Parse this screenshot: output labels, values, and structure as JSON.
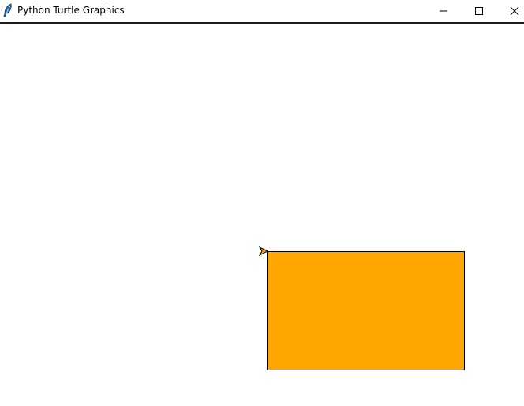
{
  "window": {
    "title": "Python Turtle Graphics",
    "controls": {
      "minimize_icon": "minimize-icon",
      "maximize_icon": "maximize-icon",
      "close_icon": "close-icon"
    }
  },
  "canvas": {
    "background": "#ffffff",
    "shape": {
      "type": "rectangle",
      "fill": "#ffa500",
      "outline": "#000000"
    },
    "turtle": {
      "fill": "#ffa500",
      "outline": "#000000",
      "heading": "east"
    }
  }
}
